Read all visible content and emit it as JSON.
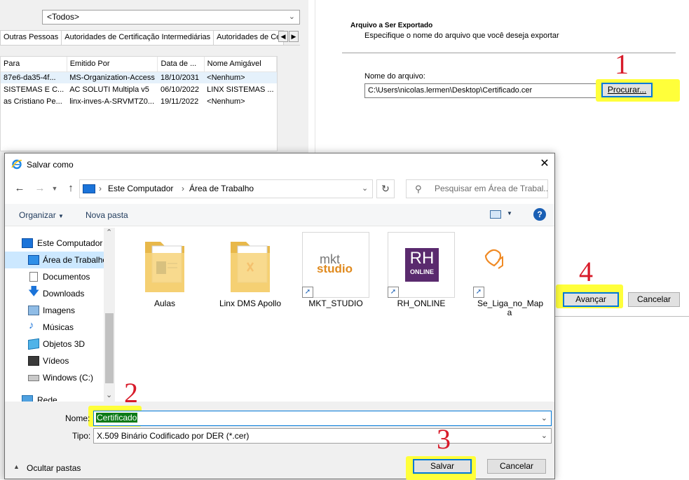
{
  "cert_manager": {
    "purpose_value": "<Todos>",
    "tabs": [
      "Outras Pessoas",
      "Autoridades de Certificação Intermediárias",
      "Autoridades de Ce"
    ],
    "columns": [
      "Para",
      "Emitido Por",
      "Data de ...",
      "Nome Amigável"
    ],
    "rows": [
      [
        "87e6-da35-4f...",
        "MS-Organization-Access",
        "18/10/2031",
        "<Nenhum>"
      ],
      [
        "SISTEMAS E C...",
        "AC SOLUTI Multipla v5",
        "06/10/2022",
        "LINX SISTEMAS ..."
      ],
      [
        "as Cristiano Pe...",
        "linx-inves-A-SRVMTZ0...",
        "19/11/2022",
        "<Nenhum>"
      ]
    ]
  },
  "export_wizard": {
    "section_title": "Arquivo a Ser Exportado",
    "section_subtitle": "Especifique o nome do arquivo que você deseja exportar",
    "filename_label": "Nome do arquivo:",
    "filename_value": "C:\\Users\\nicolas.lermen\\Desktop\\Certificado.cer",
    "browse_label": "Procurar...",
    "next_label": "Avançar",
    "cancel_label": "Cancelar"
  },
  "save_dialog": {
    "title": "Salvar como",
    "breadcrumb": [
      "Este Computador",
      "Área de Trabalho"
    ],
    "search_placeholder": "Pesquisar em Área de Trabal...",
    "toolbar": {
      "organize": "Organizar",
      "new_folder": "Nova pasta"
    },
    "sidebar": [
      {
        "label": "Este Computador",
        "icon": "computer-icon"
      },
      {
        "label": "Área de Trabalho",
        "icon": "desktop-icon",
        "selected": true
      },
      {
        "label": "Documentos",
        "icon": "documents-icon"
      },
      {
        "label": "Downloads",
        "icon": "downloads-icon"
      },
      {
        "label": "Imagens",
        "icon": "pictures-icon"
      },
      {
        "label": "Músicas",
        "icon": "music-icon"
      },
      {
        "label": "Objetos 3D",
        "icon": "objects-3d-icon"
      },
      {
        "label": "Vídeos",
        "icon": "videos-icon"
      },
      {
        "label": "Windows (C:)",
        "icon": "drive-icon"
      },
      {
        "label": "Rede",
        "icon": "network-icon"
      }
    ],
    "files": [
      {
        "name": "Aulas",
        "kind": "folder"
      },
      {
        "name": "Linx DMS Apollo",
        "kind": "folder"
      },
      {
        "name": "MKT_STUDIO",
        "kind": "shortcut",
        "logo_line1": "mkt",
        "logo_line2": "studio"
      },
      {
        "name": "RH_ONLINE",
        "kind": "shortcut",
        "logo_line1": "RH",
        "logo_line2": "ONLINE"
      },
      {
        "name": "Se_Liga_no_Map a",
        "kind": "shortcut"
      }
    ],
    "name_label": "Nome:",
    "name_value": "Certificado",
    "type_label": "Tipo:",
    "type_value": "X.509 Binário Codificado por DER (*.cer)",
    "hide_folders": "Ocultar pastas",
    "save_label": "Salvar",
    "cancel_label": "Cancelar"
  },
  "annotations": [
    "1",
    "2",
    "3",
    "4"
  ],
  "colors": {
    "highlight": "#ffff3a",
    "annotation": "#d81b2a",
    "accent": "#0078d7"
  }
}
